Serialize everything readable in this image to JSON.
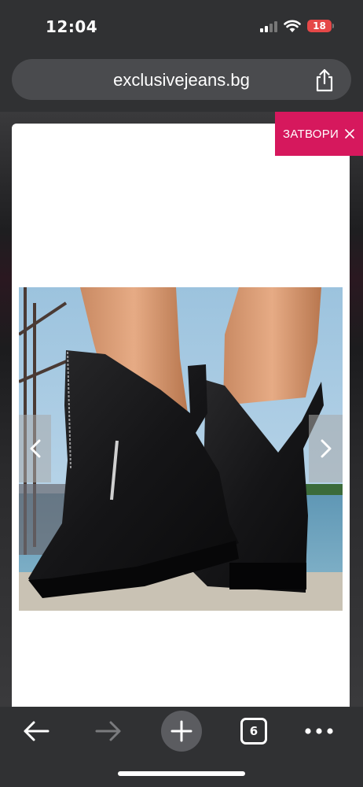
{
  "status_bar": {
    "time": "12:04",
    "battery_level": "18",
    "signal_icon": "cellular-signal-icon",
    "wifi_icon": "wifi-icon"
  },
  "browser": {
    "url": "exclusivejeans.bg",
    "share_icon": "share-icon"
  },
  "modal": {
    "close_label": "ЗАТВОРИ",
    "close_icon": "close-icon",
    "accent_color": "#d6185d",
    "image_alt": "black leather ankle boots with front zipper on a pier by the sea",
    "prev_icon": "chevron-left-icon",
    "next_icon": "chevron-right-icon"
  },
  "toolbar": {
    "back_icon": "back-arrow-icon",
    "forward_icon": "forward-arrow-icon",
    "new_tab_icon": "plus-icon",
    "tab_count": "6",
    "more_icon": "more-dots-icon"
  }
}
